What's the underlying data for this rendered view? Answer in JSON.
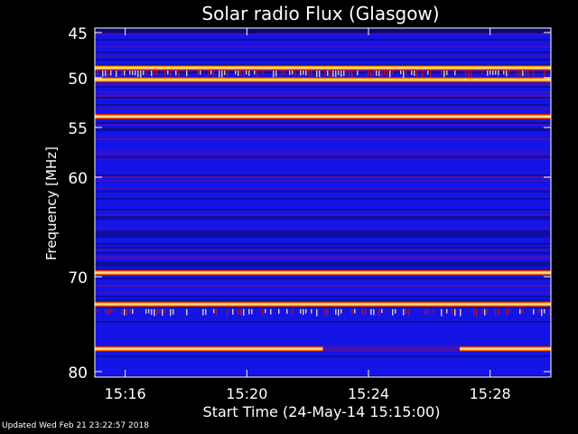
{
  "chart_data": {
    "type": "heatmap",
    "title": "Solar radio Flux (Glasgow)",
    "ylabel": "Frequency [MHz]",
    "xlabel": "Start Time (24-May-14 15:15:00)",
    "y_ticks": [
      "45",
      "50",
      "55",
      "60",
      "70",
      "80"
    ],
    "x_ticks": [
      "15:16",
      "15:20",
      "15:24",
      "15:28"
    ],
    "y_range_mhz": [
      45,
      80
    ],
    "x_range": [
      "15:15:00",
      "15:30:00"
    ],
    "colormap": [
      "#0a0a6e",
      "#1414e6",
      "#6a0aa0",
      "#d01010",
      "#ff8a00",
      "#fff0a0"
    ],
    "bright_bands_mhz": [
      48.9,
      50.2,
      53.9,
      69.6,
      72.9,
      77.6
    ],
    "gap_in_77_6_band": [
      "15:22:30",
      "15:27:00"
    ],
    "footer": "Updated Wed Feb 21 23:22:57 2018"
  }
}
